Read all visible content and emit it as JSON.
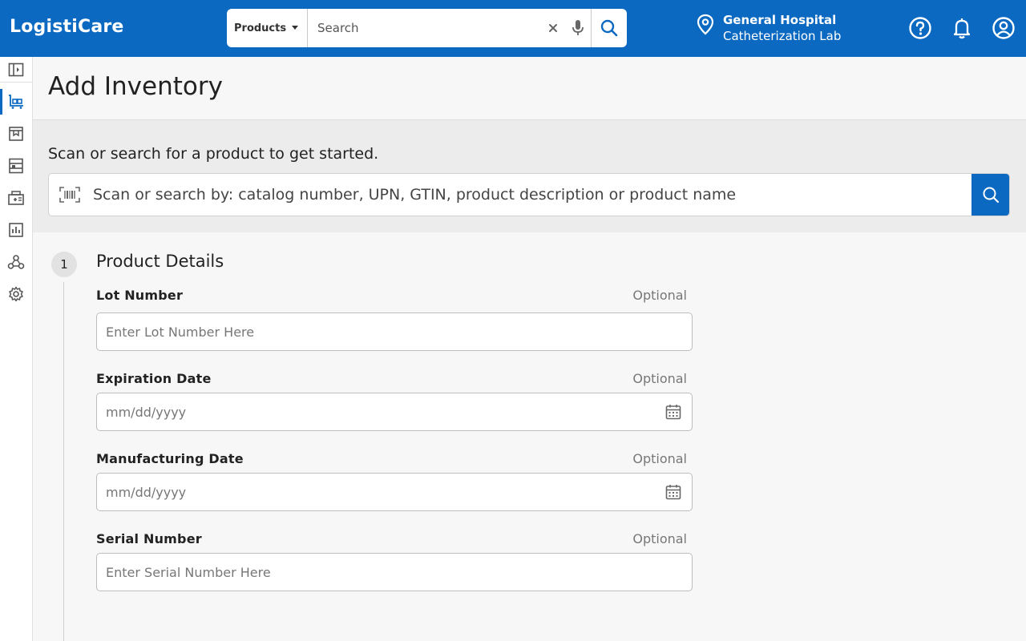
{
  "app": {
    "brand": "LogistiCare"
  },
  "topbar": {
    "scope_label": "Products",
    "search_placeholder": "Search",
    "location_name": "General Hospital",
    "location_sub": "Catheterization Lab"
  },
  "colors": {
    "primary": "#0b69c2",
    "band": "#ececec"
  },
  "sidebar": {
    "items": [
      {
        "icon": "panel-toggle-icon"
      },
      {
        "icon": "cart-icon",
        "active": true
      },
      {
        "icon": "inventory-icon"
      },
      {
        "icon": "shelves-icon"
      },
      {
        "icon": "medical-kit-icon"
      },
      {
        "icon": "reports-icon"
      },
      {
        "icon": "integrations-icon"
      },
      {
        "icon": "gear-icon"
      }
    ]
  },
  "page": {
    "title": "Add Inventory"
  },
  "scan": {
    "prompt": "Scan or search for a product to get started.",
    "placeholder": "Scan or search by: catalog number, UPN, GTIN, product description or product name"
  },
  "step": {
    "number": "1",
    "title": "Product Details",
    "fields": [
      {
        "label": "Lot Number",
        "optional": "Optional",
        "placeholder": "Enter Lot Number Here"
      },
      {
        "label": "Expiration Date",
        "optional": "Optional",
        "placeholder": "mm/dd/yyyy"
      },
      {
        "label": "Manufacturing Date",
        "optional": "Optional",
        "placeholder": "mm/dd/yyyy"
      },
      {
        "label": "Serial Number",
        "optional": "Optional",
        "placeholder": "Enter Serial Number Here"
      }
    ]
  }
}
